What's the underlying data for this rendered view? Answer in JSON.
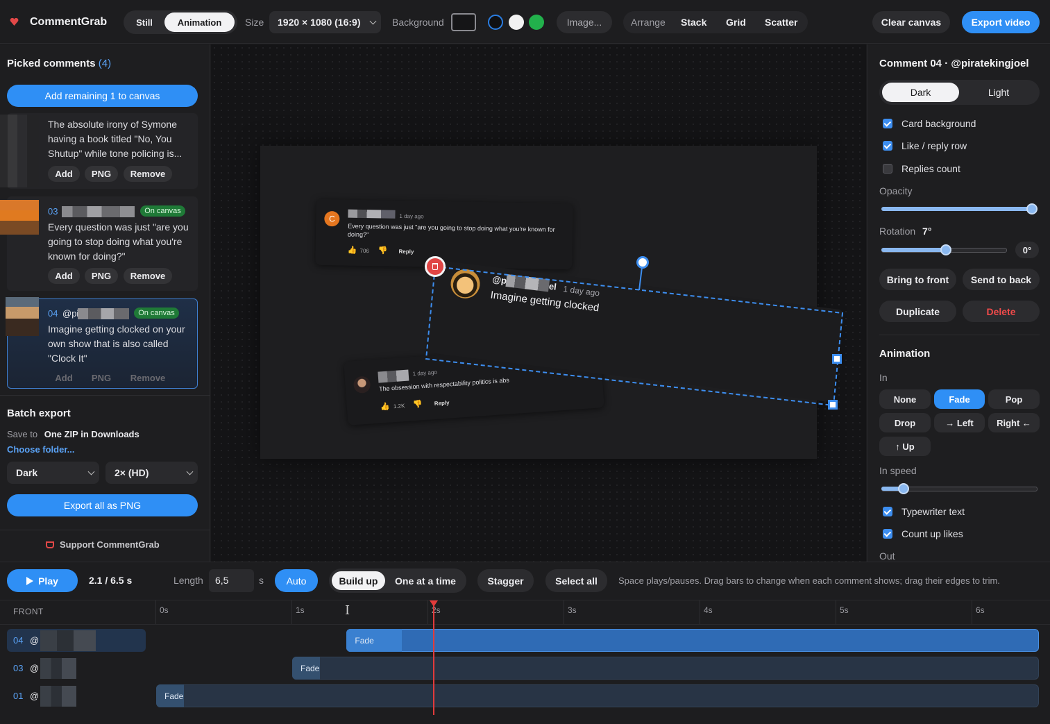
{
  "app": {
    "name": "CommentGrab"
  },
  "toolbar": {
    "mode_still": "Still",
    "mode_animation": "Animation",
    "size_label": "Size",
    "size_value": "1920 × 1080 (16:9)",
    "background_label": "Background",
    "image_button": "Image...",
    "arrange_label": "Arrange",
    "arrange_stack": "Stack",
    "arrange_grid": "Grid",
    "arrange_scatter": "Scatter",
    "clear_canvas": "Clear canvas",
    "export_video": "Export video",
    "colors": {
      "blue": "#2a7de1",
      "white": "#f2f2f2",
      "green": "#22b14c",
      "accent": "#2f8ff5"
    }
  },
  "left": {
    "title": "Picked comments",
    "count": "(4)",
    "add_remaining": "Add remaining 1 to canvas",
    "comments": [
      {
        "num": "",
        "badge": "",
        "text": "The absolute irony of Symone having a book titled \"No, You Shutup\" while tone policing is...",
        "add": "Add",
        "png": "PNG",
        "remove": "Remove"
      },
      {
        "num": "03",
        "badge": "On canvas",
        "text": "Every question was just \"are you going to stop doing what you're known for doing?\"",
        "add": "Add",
        "png": "PNG",
        "remove": "Remove"
      },
      {
        "num": "04",
        "handle": "@pi",
        "badge": "On canvas",
        "text": "Imagine getting clocked on your own show that is also called \"Clock It\"",
        "add": "Add",
        "png": "PNG",
        "remove": "Remove"
      }
    ],
    "batch_title": "Batch export",
    "save_to_label": "Save to",
    "save_to_value": "One ZIP in Downloads",
    "choose_folder": "Choose folder...",
    "theme_select": "Dark",
    "scale_select": "2× (HD)",
    "export_all": "Export all as PNG",
    "support": "Support CommentGrab"
  },
  "canvas": {
    "card1": {
      "avatar_letter": "C",
      "time": "1 day ago",
      "text": "Every question was just \"are you going to stop doing what you're known for doing?\"",
      "likes": "706",
      "reply": "Reply"
    },
    "card2": {
      "handle_prefix": "@p",
      "handle_suffix": "el",
      "time": "1 day ago",
      "text": "Imagine getting clocked"
    },
    "card3": {
      "time": "1 day ago",
      "text": "The obsession with respectability politics is abs",
      "likes": "1.2K",
      "reply": "Reply"
    }
  },
  "right": {
    "title": "Comment 04 · @piratekingjoel",
    "theme_dark": "Dark",
    "theme_light": "Light",
    "card_background": "Card background",
    "like_reply_row": "Like / reply row",
    "replies_count": "Replies count",
    "opacity_label": "Opacity",
    "opacity_value": 1.0,
    "rotation_label": "Rotation",
    "rotation_value": "7°",
    "rotation_reset": "0°",
    "bring_front": "Bring to front",
    "send_back": "Send to back",
    "duplicate": "Duplicate",
    "delete": "Delete",
    "animation_title": "Animation",
    "in_label": "In",
    "anim_none": "None",
    "anim_fade": "Fade",
    "anim_pop": "Pop",
    "anim_drop": "Drop",
    "anim_left": "→ Left",
    "anim_right": "Right ←",
    "anim_up": "↑ Up",
    "in_speed_label": "In speed",
    "typewriter": "Typewriter text",
    "count_up": "Count up likes",
    "out_label": "Out"
  },
  "timeline": {
    "play": "Play",
    "time": "2.1 / 6.5 s",
    "length_label": "Length",
    "length_value": "6,5",
    "length_unit": "s",
    "auto": "Auto",
    "build_up": "Build up",
    "one_at_a_time": "One at a time",
    "stagger": "Stagger",
    "select_all": "Select all",
    "hint": "Space plays/pauses. Drag bars to change when each comment shows; drag their edges to trim.",
    "front_label": "FRONT",
    "ticks": [
      "0s",
      "1s",
      "2s",
      "3s",
      "4s",
      "5s",
      "6s"
    ],
    "playhead_seconds": 2.1,
    "tracks": [
      {
        "num": "04",
        "at": "@",
        "label": "Fade",
        "start": 1.4,
        "selected": true
      },
      {
        "num": "03",
        "at": "@",
        "label": "Fade",
        "start": 1.0,
        "selected": false
      },
      {
        "num": "01",
        "at": "@",
        "label": "Fade",
        "start": 0.0,
        "selected": false
      }
    ]
  }
}
